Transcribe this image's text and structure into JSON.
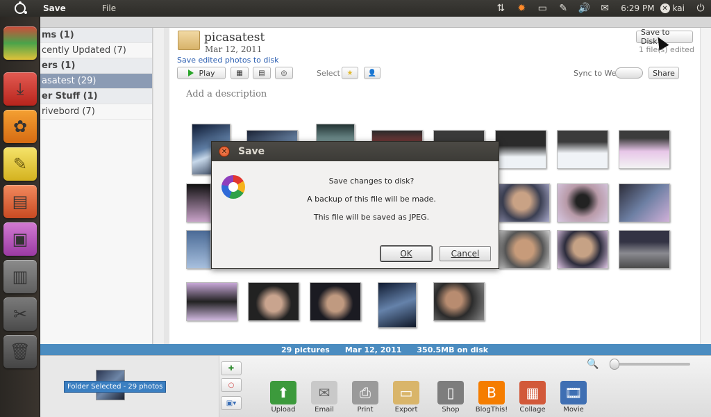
{
  "topbar": {
    "app_title": "Save",
    "menus": [
      "File"
    ],
    "time": "6:29 PM",
    "user": "kai"
  },
  "left_panel": {
    "rows": [
      {
        "label": "ms (1)",
        "type": "header"
      },
      {
        "label": "cently Updated (7)",
        "type": "item"
      },
      {
        "label": "ers (1)",
        "type": "header"
      },
      {
        "label": "asatest (29)",
        "type": "selected"
      },
      {
        "label": "er Stuff (1)",
        "type": "header"
      },
      {
        "label": "rivebord (7)",
        "type": "item"
      }
    ]
  },
  "album": {
    "title": "picasatest",
    "date": "Mar 12, 2011",
    "save_link": "Save edited photos to disk",
    "save_to_disk": "Save to Disk",
    "files_edited": "1 file(s) edited",
    "play": "Play",
    "select": "Select",
    "sync": "Sync to Web",
    "share": "Share",
    "description_placeholder": "Add a description"
  },
  "status": {
    "count": "29 pictures",
    "date": "Mar 12, 2011",
    "size": "350.5MB on disk"
  },
  "tray": {
    "folder_badge": "Folder Selected - 29 photos",
    "actions": [
      {
        "label": "Upload",
        "icon": "upload-icon",
        "color": "#3c9a3c"
      },
      {
        "label": "Email",
        "icon": "email-icon",
        "color": "#c9c9c9"
      },
      {
        "label": "Print",
        "icon": "print-icon",
        "color": "#9a9a9a"
      },
      {
        "label": "Export",
        "icon": "export-icon",
        "color": "#d9b56a"
      },
      {
        "label": "Shop",
        "icon": "shop-icon",
        "color": "#7d7d7d"
      },
      {
        "label": "BlogThis!",
        "icon": "blogger-icon",
        "color": "#f57d00"
      },
      {
        "label": "Collage",
        "icon": "collage-icon",
        "color": "#d2593a"
      },
      {
        "label": "Movie",
        "icon": "movie-icon",
        "color": "#3f6fb3"
      }
    ]
  },
  "dialog": {
    "title": "Save",
    "line1": "Save changes to disk?",
    "line2": "A backup of this file will be made.",
    "line3": "This file will be saved as JPEG.",
    "ok": "OK",
    "cancel": "Cancel"
  }
}
